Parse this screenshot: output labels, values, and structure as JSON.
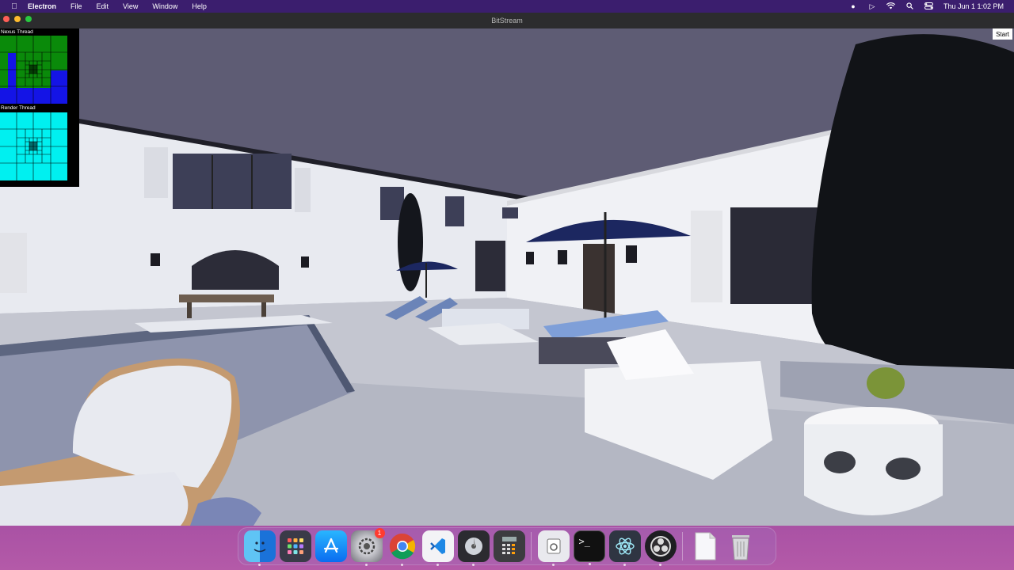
{
  "menubar": {
    "app_name": "Electron",
    "menus": [
      "File",
      "Edit",
      "View",
      "Window",
      "Help"
    ],
    "clock": "Thu Jun 1  1:02 PM",
    "status_icons": [
      "voice-control-icon",
      "play-circle-icon",
      "wifi-icon",
      "spotlight-search-icon",
      "control-center-icon"
    ]
  },
  "window": {
    "title": "BitStream",
    "start_button": "Start"
  },
  "debug": {
    "nexus_label": "Nexus Thread",
    "render_label": "Render Thread",
    "nexus_colors": {
      "primary": "#0a8a0a",
      "secondary": "#1414e6"
    },
    "render_color": "#00f0f0"
  },
  "dock": {
    "apps": [
      {
        "name": "Finder",
        "icon": "finder-icon",
        "running": true
      },
      {
        "name": "Launchpad",
        "icon": "launchpad-icon",
        "running": false
      },
      {
        "name": "App Store",
        "icon": "app-store-icon",
        "running": false
      },
      {
        "name": "System Settings",
        "icon": "system-settings-icon",
        "running": true,
        "badge": "1"
      },
      {
        "name": "Google Chrome",
        "icon": "chrome-icon",
        "running": true
      },
      {
        "name": "Visual Studio Code",
        "icon": "vscode-icon",
        "running": true
      },
      {
        "name": "Disk Utility",
        "icon": "disk-icon",
        "running": true
      },
      {
        "name": "Calculator",
        "icon": "calculator-icon",
        "running": false
      },
      {
        "name": "Preview",
        "icon": "preview-icon",
        "running": true
      },
      {
        "name": "Terminal",
        "icon": "terminal-icon",
        "running": true
      },
      {
        "name": "Electron",
        "icon": "electron-icon",
        "running": true
      },
      {
        "name": "OBS",
        "icon": "obs-icon",
        "running": true
      },
      {
        "name": "Document",
        "icon": "document-icon",
        "running": false
      },
      {
        "name": "Trash",
        "icon": "trash-icon",
        "running": false
      }
    ]
  }
}
